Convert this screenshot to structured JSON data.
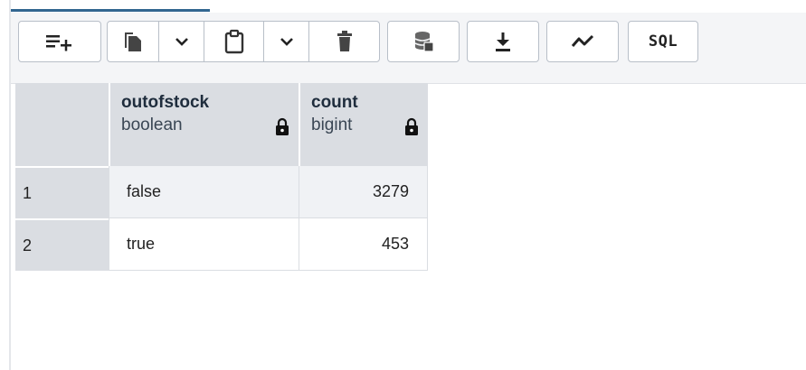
{
  "toolbar": {
    "buttons": [
      {
        "icon": "add-row-icon"
      },
      {
        "icon": "copy-icon"
      },
      {
        "icon": "paste-icon"
      },
      {
        "icon": "delete-icon"
      },
      {
        "icon": "save-data-icon"
      },
      {
        "icon": "download-icon"
      },
      {
        "icon": "graph-icon"
      },
      {
        "icon": "sql-icon",
        "label": "SQL"
      }
    ]
  },
  "grid": {
    "columns": [
      {
        "name": "outofstock",
        "type": "boolean",
        "locked": true
      },
      {
        "name": "count",
        "type": "bigint",
        "locked": true
      }
    ],
    "rows": [
      {
        "num": "1",
        "outofstock": "false",
        "count": "3279"
      },
      {
        "num": "2",
        "outofstock": "true",
        "count": "453"
      }
    ]
  },
  "colors": {
    "accent": "#326690",
    "header_bg": "#dadde2",
    "toolbar_bg": "#f4f5f7"
  }
}
